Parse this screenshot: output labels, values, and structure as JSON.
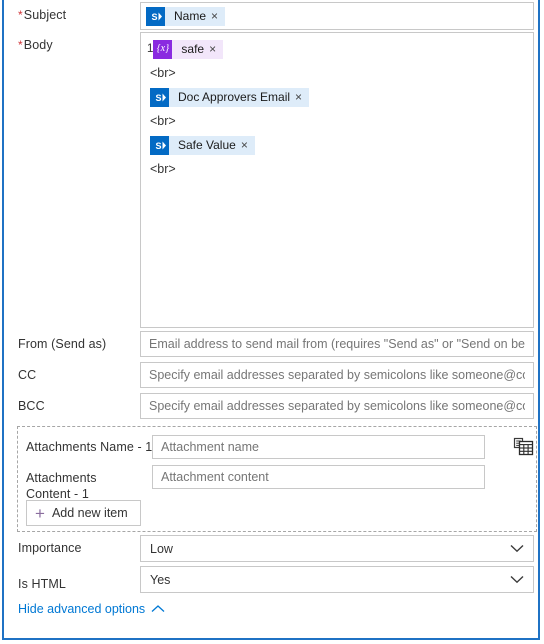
{
  "card": {
    "accent_color": "#1f72c4",
    "token_bg": "#deecf9",
    "variable_token_bg": "#f2e6fa",
    "variable_icon_color": "#8a2be0",
    "sharepoint_icon_color": "#036ac4",
    "link_color": "#0078d4",
    "required_star_color": "#d13438"
  },
  "fields": {
    "to": {
      "label": "",
      "token": {
        "name": "",
        "icon": "sharepoint-icon"
      }
    },
    "subject": {
      "label": "Subject",
      "required": true,
      "required_marker": "*",
      "token": {
        "name": "Name",
        "icon": "sharepoint-icon",
        "remove": "×"
      }
    },
    "body": {
      "label": "Body",
      "required": true,
      "required_marker": "*",
      "lines": [
        {
          "type": "token",
          "linenum": "1",
          "kind": "variable",
          "icon": "{x}",
          "name": "safe",
          "remove": "×"
        },
        {
          "type": "text",
          "text": "<br>"
        },
        {
          "type": "token",
          "kind": "sharepoint",
          "icon": "sharepoint-icon",
          "name": "Doc Approvers Email",
          "remove": "×"
        },
        {
          "type": "text",
          "text": "<br>"
        },
        {
          "type": "token",
          "kind": "sharepoint",
          "icon": "sharepoint-icon",
          "name": "Safe Value",
          "remove": "×"
        },
        {
          "type": "text",
          "text": "<br>"
        }
      ]
    },
    "from": {
      "label": "From (Send as)",
      "placeholder": "Email address to send mail from (requires \"Send as\" or \"Send on behalf of\""
    },
    "cc": {
      "label": "CC",
      "placeholder": "Specify email addresses separated by semicolons like someone@contoso.com"
    },
    "bcc": {
      "label": "BCC",
      "placeholder": "Specify email addresses separated by semicolons like someone@contoso.com"
    }
  },
  "attachments": {
    "name_row": {
      "label": "Attachments Name - 1",
      "placeholder": "Attachment name"
    },
    "content_row": {
      "label": "Attachments Content - 1",
      "placeholder": "Attachment content"
    },
    "add_button": {
      "label": "Add new item",
      "icon": "plus-icon"
    },
    "switch_icon": "switch-to-array-icon"
  },
  "importance": {
    "label": "Importance",
    "value": "Low",
    "chevron": "chevron-down-icon"
  },
  "is_html": {
    "label": "Is HTML",
    "value": "Yes",
    "chevron": "chevron-down-icon"
  },
  "advanced": {
    "label": "Hide advanced options",
    "caret": "chevron-up-icon"
  }
}
